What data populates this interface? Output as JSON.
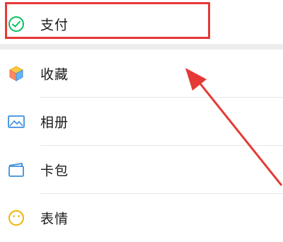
{
  "menu": {
    "items": [
      {
        "label": "支付",
        "icon": "wallet-check-icon",
        "color": "#07c160"
      },
      {
        "label": "收藏",
        "icon": "cube-icon"
      },
      {
        "label": "相册",
        "icon": "photo-icon",
        "color": "#3d8fdc"
      },
      {
        "label": "卡包",
        "icon": "card-wallet-icon",
        "color": "#3d8fdc"
      },
      {
        "label": "表情",
        "icon": "smile-icon",
        "color": "#f2b400"
      }
    ]
  },
  "annotation": {
    "highlight_color": "#e53935",
    "arrow_color": "#e53935"
  }
}
